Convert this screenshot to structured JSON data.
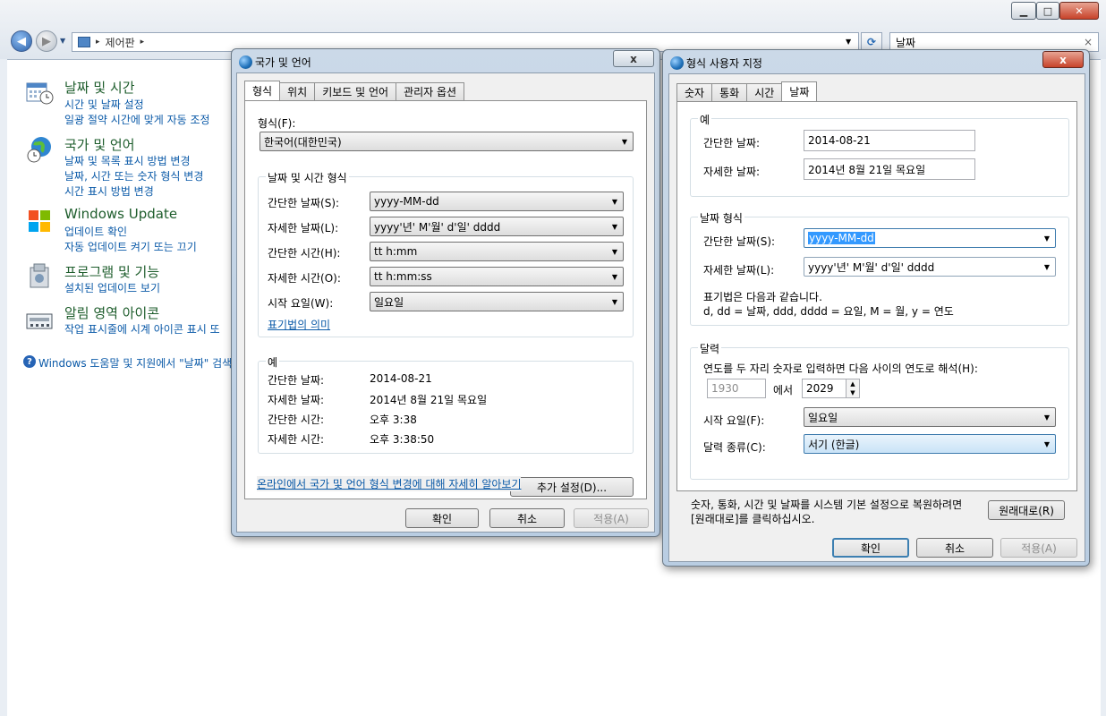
{
  "control_panel": {
    "title": "제어판",
    "breadcrumb_sep": "▸",
    "search_value": "날짜",
    "search_clear": "×",
    "categories": [
      {
        "title": "날짜 및 시간",
        "icon": "calendar-clock-icon",
        "links": [
          "시간 및 날짜 설정",
          "일광 절약 시간에 맞게 자동 조정"
        ]
      },
      {
        "title": "국가 및 언어",
        "icon": "globe-clock-icon",
        "links": [
          "날짜 및 목록 표시 방법 변경",
          "날짜, 시간 또는 숫자 형식 변경",
          "시간 표시 방법 변경"
        ]
      },
      {
        "title": "Windows Update",
        "icon": "windows-update-icon",
        "links": [
          "업데이트 확인",
          "자동 업데이트 켜기 또는 끄기"
        ]
      },
      {
        "title": "프로그램 및 기능",
        "icon": "programs-icon",
        "links": [
          "설치된 업데이트 보기"
        ]
      },
      {
        "title": "알림 영역 아이콘",
        "icon": "notification-area-icon",
        "links": [
          "작업 표시줄에 시계 아이콘 표시 또"
        ]
      }
    ],
    "help_text": "Windows 도움말 및 지원에서 \"날짜\" 검색"
  },
  "region_dialog": {
    "title": "국가 및 언어",
    "close": "x",
    "tabs": [
      "형식",
      "위치",
      "키보드 및 언어",
      "관리자 옵션"
    ],
    "format_label": "형식(F):",
    "format_value": "한국어(대한민국)",
    "dt_group_label": "날짜 및 시간 형식",
    "rows": [
      {
        "label": "간단한 날짜(S):",
        "value": "yyyy-MM-dd"
      },
      {
        "label": "자세한 날짜(L):",
        "value": "yyyy'년' M'월' d'일' dddd"
      },
      {
        "label": "간단한 시간(H):",
        "value": "tt h:mm"
      },
      {
        "label": "자세한 시간(O):",
        "value": "tt h:mm:ss"
      },
      {
        "label": "시작 요일(W):",
        "value": "일요일"
      }
    ],
    "notation_link": "표기법의 의미",
    "example_group_label": "예",
    "examples": [
      {
        "label": "간단한 날짜:",
        "value": "2014-08-21"
      },
      {
        "label": "자세한 날짜:",
        "value": "2014년 8월 21일 목요일"
      },
      {
        "label": "간단한 시간:",
        "value": "오후 3:38"
      },
      {
        "label": "자세한 시간:",
        "value": "오후 3:38:50"
      }
    ],
    "additional_button": "추가 설정(D)...",
    "online_link": "온라인에서 국가 및 언어 형식 변경에 대해 자세히 알아보기",
    "ok": "확인",
    "cancel": "취소",
    "apply": "적용(A)"
  },
  "custom_dialog": {
    "title": "형식 사용자 지정",
    "close": "x",
    "tabs": [
      "숫자",
      "통화",
      "시간",
      "날짜"
    ],
    "example_group_label": "예",
    "example_short_label": "간단한 날짜:",
    "example_short_value": "2014-08-21",
    "example_long_label": "자세한 날짜:",
    "example_long_value": "2014년 8월 21일 목요일",
    "date_format_group_label": "날짜 형식",
    "short_label": "간단한 날짜(S):",
    "short_value": "yyyy-MM-dd",
    "long_label": "자세한 날짜(L):",
    "long_value": "yyyy'년' M'월' d'일' dddd",
    "notation_line1": "표기법은 다음과 같습니다.",
    "notation_line2": "d, dd = 날짜,  ddd, dddd = 요일,  M = 월,  y = 연도",
    "calendar_group_label": "달력",
    "two_digit_text": "연도를 두 자리 숫자로 입력하면 다음 사이의 연도로 해석(H):",
    "year_from": "1930",
    "year_between": "에서",
    "year_to": "2029",
    "first_day_label": "시작 요일(F):",
    "first_day_value": "일요일",
    "calendar_type_label": "달력 종류(C):",
    "calendar_type_value": "서기 (한글)",
    "reset_text_line1": "숫자, 통화, 시간 및 날짜를 시스템 기본 설정으로 복원하려면",
    "reset_text_line2": "[원래대로]를 클릭하십시오.",
    "reset_button": "원래대로(R)",
    "ok": "확인",
    "cancel": "취소",
    "apply": "적용(A)"
  }
}
